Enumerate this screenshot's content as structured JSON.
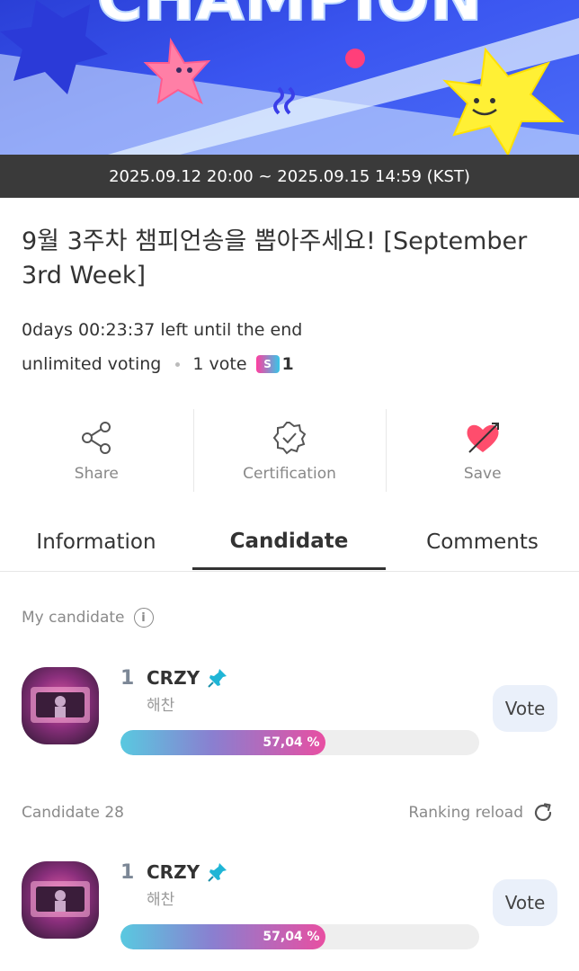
{
  "banner": {
    "title_text": "CHAMPION",
    "date_range": "2025.09.12 20:00 ~ 2025.09.15 14:59 (KST)"
  },
  "poll": {
    "title": "9월 3주차 챔피언송을 뽑아주세요! [September 3rd Week]",
    "countdown": "0days 00:23:37 left until the end",
    "voting_type": "unlimited voting",
    "vote_cost": "1 vote",
    "ticket_count": "1"
  },
  "actions": [
    {
      "label": "Share",
      "icon": "share-icon"
    },
    {
      "label": "Certification",
      "icon": "certification-badge-icon"
    },
    {
      "label": "Save",
      "icon": "heart-arrow-icon"
    }
  ],
  "tabs": [
    {
      "label": "Information",
      "active": false
    },
    {
      "label": "Candidate",
      "active": true
    },
    {
      "label": "Comments",
      "active": false
    }
  ],
  "my_candidate": {
    "section_label": "My candidate",
    "rank": "1",
    "song": "CRZY",
    "artist": "해찬",
    "percent_label": "57,04 %",
    "percent": 57.04,
    "vote_label": "Vote"
  },
  "candidates": {
    "section_label": "Candidate 28",
    "reload_label": "Ranking reload",
    "items": [
      {
        "rank": "1",
        "song": "CRZY",
        "artist": "해찬",
        "percent_label": "57,04 %",
        "percent": 57.04,
        "vote_label": "Vote"
      }
    ]
  },
  "colors": {
    "date_bar": "#3a3a3a",
    "bar_gradient_start": "#59c9e0",
    "bar_gradient_end": "#e84fa2",
    "vote_button_bg": "#eaf0fa",
    "pin": "#1fb5d6"
  }
}
